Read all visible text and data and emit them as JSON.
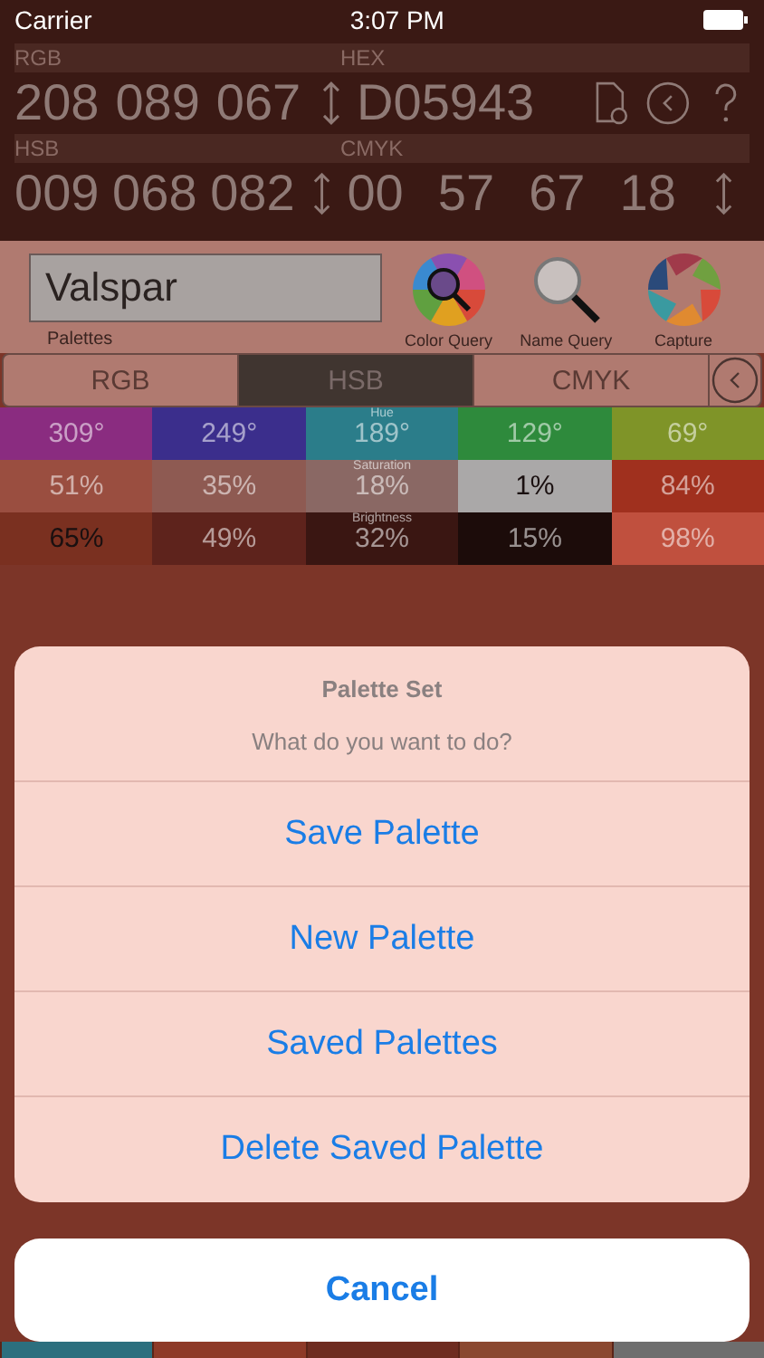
{
  "status_bar": {
    "carrier": "Carrier",
    "time": "3:07 PM"
  },
  "rgb": {
    "label": "RGB",
    "values": [
      "208",
      "089",
      "067"
    ]
  },
  "hex": {
    "label": "HEX",
    "value": "D05943"
  },
  "hsb": {
    "label": "HSB",
    "values": [
      "009",
      "068",
      "082"
    ]
  },
  "cmyk": {
    "label": "CMYK",
    "values": [
      "00",
      "57",
      "67",
      "18"
    ]
  },
  "palette_field": {
    "value": "Valspar",
    "label": "Palettes"
  },
  "tools": [
    {
      "label": "Color Query",
      "kind": "wheel"
    },
    {
      "label": "Name Query",
      "kind": "magnifier"
    },
    {
      "label": "Capture",
      "kind": "aperture"
    }
  ],
  "tabs": [
    {
      "label": "RGB",
      "selected": false
    },
    {
      "label": "HSB",
      "selected": true
    },
    {
      "label": "CMYK",
      "selected": false
    }
  ],
  "grid": [
    {
      "label": "Hue",
      "cells": [
        {
          "text": "309°",
          "color": "#8a2c80"
        },
        {
          "text": "249°",
          "color": "#3b2e8c"
        },
        {
          "text": "189°",
          "color": "#2b7d8a"
        },
        {
          "text": "129°",
          "color": "#2e8a3c"
        },
        {
          "text": "69°",
          "color": "#7f9428"
        }
      ]
    },
    {
      "label": "Saturation",
      "cells": [
        {
          "text": "51%",
          "color": "#9a4e40"
        },
        {
          "text": "35%",
          "color": "#8e5a52"
        },
        {
          "text": "18%",
          "color": "#8a6864"
        },
        {
          "text": "1%",
          "color": "#aaa8a8"
        },
        {
          "text": "84%",
          "color": "#a0301e"
        }
      ]
    },
    {
      "label": "Brightness",
      "cells": [
        {
          "text": "65%",
          "color": "#7a3020"
        },
        {
          "text": "49%",
          "color": "#5e231c"
        },
        {
          "text": "32%",
          "color": "#3a1612"
        },
        {
          "text": "15%",
          "color": "#1c0c0a"
        },
        {
          "text": "98%",
          "color": "#c0503e"
        }
      ]
    }
  ],
  "bottom_swatches": [
    {
      "color": "#2c6f7e"
    },
    {
      "color": "#8e3a28"
    },
    {
      "color": "#6e2c20"
    },
    {
      "color": "#8a4830"
    },
    {
      "color": "#6e6e6e"
    }
  ],
  "action_sheet": {
    "title": "Palette Set",
    "message": "What do you want to do?",
    "actions": [
      "Save Palette",
      "New Palette",
      "Saved Palettes",
      "Delete Saved Palette"
    ],
    "cancel": "Cancel"
  }
}
